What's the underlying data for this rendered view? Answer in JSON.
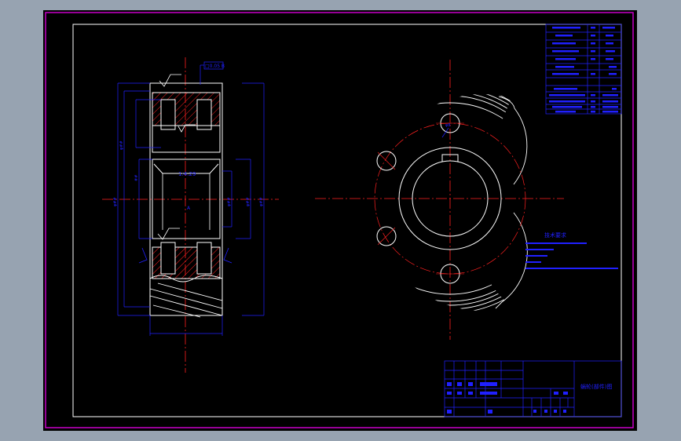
{
  "window": {
    "background_color": "#97a3b1",
    "sheet_color": "#000000"
  },
  "colors": {
    "outer_frame": "#c800c8",
    "inner_frame": "#ffffff",
    "geometry": "#ffffff",
    "centerline": "#ff2020",
    "section_hatch": "#ff2020",
    "dimension": "#2020ff",
    "leader": "#2020ff",
    "table": "#2020ff"
  },
  "drawing": {
    "surface_finish_callout": "□0.05 B",
    "hub_taper_label": "1:4.29",
    "datum_label": "A",
    "notes_title": "技术要求",
    "title_block_name": "蜗轮(部件)图"
  },
  "icons": {
    "surface_finish": "roughness-symbol-icon",
    "datum": "datum-triangle-icon"
  }
}
